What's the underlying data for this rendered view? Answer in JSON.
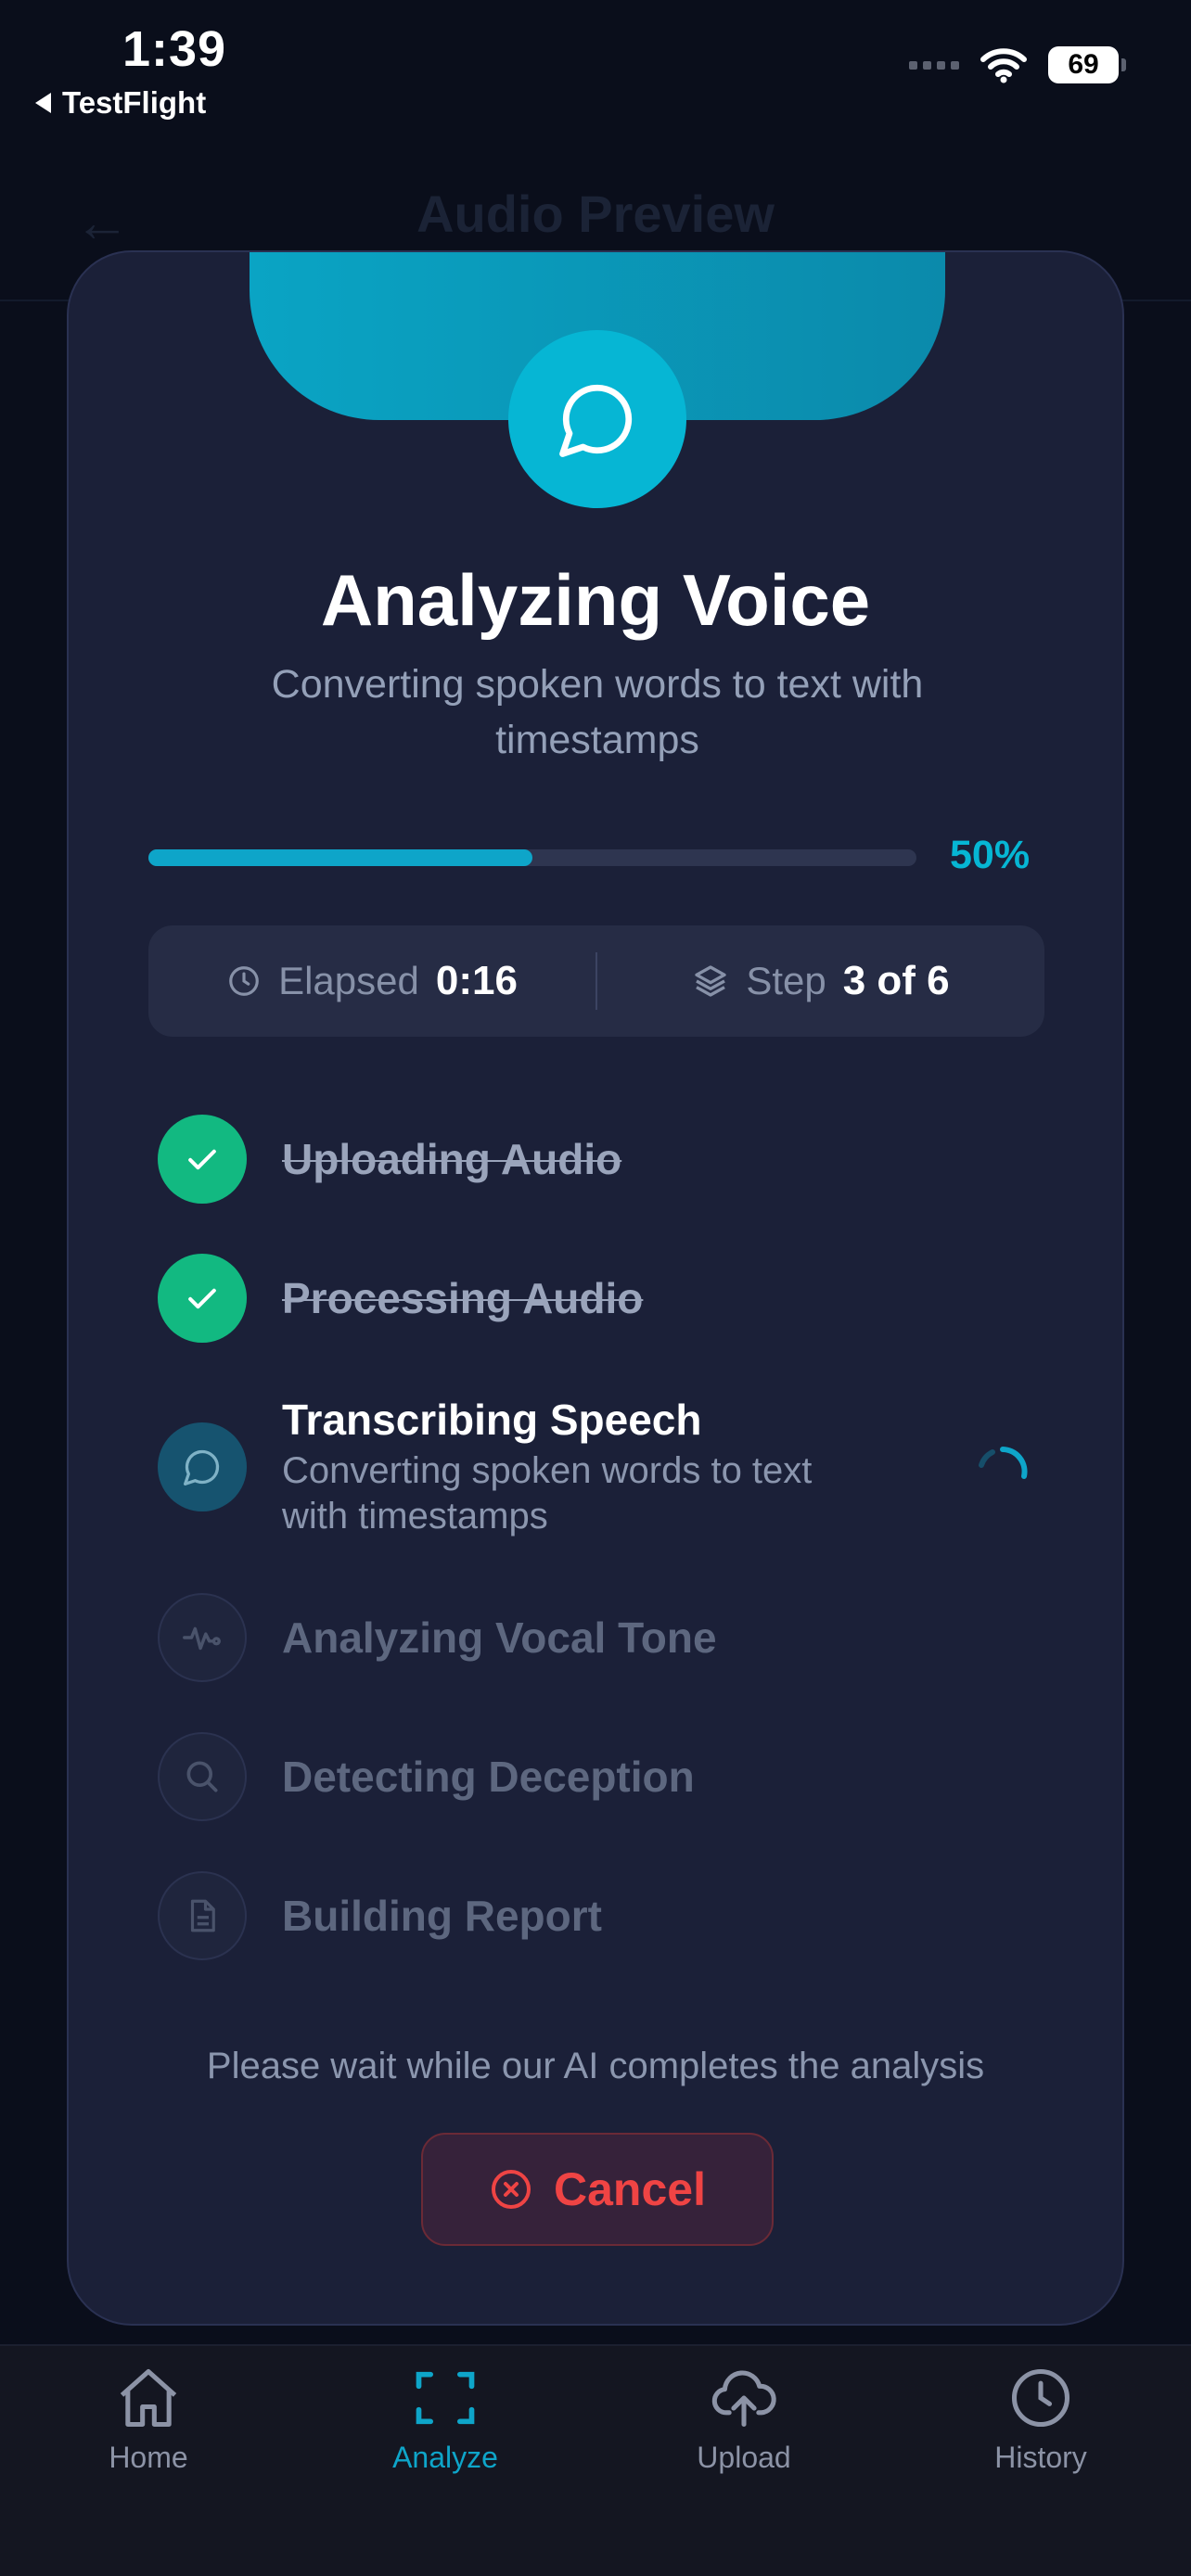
{
  "status_bar": {
    "time": "1:39",
    "back_app": "TestFlight",
    "battery": "69"
  },
  "background": {
    "title": "Audio Preview"
  },
  "modal": {
    "title": "Analyzing Voice",
    "subtitle": "Converting spoken words to text with timestamps",
    "progress_percent": 50,
    "progress_label": "50%",
    "elapsed_label": "Elapsed",
    "elapsed_value": "0:16",
    "step_label": "Step",
    "step_value": "3 of 6",
    "steps": [
      {
        "name": "Uploading Audio",
        "state": "done",
        "icon": "check-icon"
      },
      {
        "name": "Processing Audio",
        "state": "done",
        "icon": "check-icon"
      },
      {
        "name": "Transcribing Speech",
        "state": "active",
        "icon": "message-circle-icon",
        "description": "Converting spoken words to text with timestamps"
      },
      {
        "name": "Analyzing Vocal Tone",
        "state": "pending",
        "icon": "waveform-icon"
      },
      {
        "name": "Detecting Deception",
        "state": "pending",
        "icon": "search-icon"
      },
      {
        "name": "Building Report",
        "state": "pending",
        "icon": "document-icon"
      }
    ],
    "wait_text": "Please wait while our AI completes the analysis",
    "cancel_label": "Cancel"
  },
  "tabbar": {
    "items": [
      {
        "label": "Home",
        "icon": "home-icon",
        "active": false
      },
      {
        "label": "Analyze",
        "icon": "scan-icon",
        "active": true
      },
      {
        "label": "Upload",
        "icon": "cloud-upload-icon",
        "active": false
      },
      {
        "label": "History",
        "icon": "clock-icon",
        "active": false
      }
    ]
  },
  "colors": {
    "accent": "#06b6d4",
    "success": "#12b981",
    "danger": "#ef4444",
    "modal_bg": "#1b2038",
    "page_bg": "#0a0e1b"
  }
}
